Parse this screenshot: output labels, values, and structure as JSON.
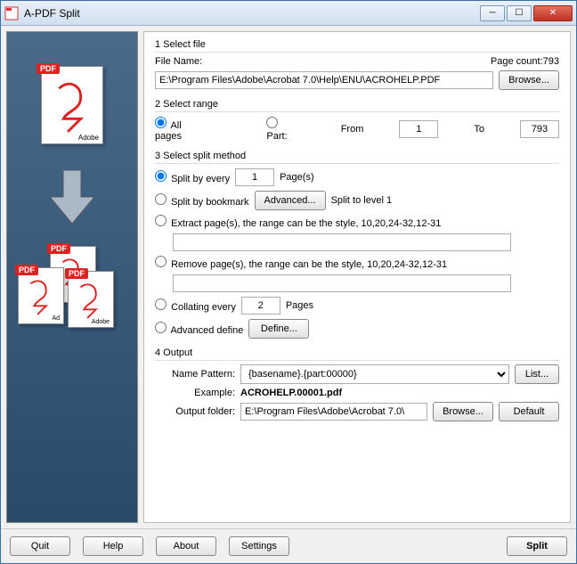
{
  "window": {
    "title": "A-PDF Split"
  },
  "section1": {
    "title": "1 Select file",
    "fileNameLabel": "File Name:",
    "fileName": "E:\\Program Files\\Adobe\\Acrobat 7.0\\Help\\ENU\\ACROHELP.PDF",
    "browse": "Browse...",
    "pageCountLabel": "Page count:",
    "pageCount": "793"
  },
  "section2": {
    "title": "2 Select range",
    "allPages": "All pages",
    "part": "Part:",
    "fromLabel": "From",
    "fromValue": "1",
    "toLabel": "To",
    "toValue": "793"
  },
  "section3": {
    "title": "3 Select split method",
    "splitEvery": "Split by every",
    "splitEveryValue": "1",
    "pagesSuffix": "Page(s)",
    "splitBookmark": "Split by bookmark",
    "advanced": "Advanced...",
    "splitToLevel": "Split to level 1",
    "extractPages": "Extract page(s), the range can be the style, 10,20,24-32,12-31",
    "removePages": "Remove page(s), the range can be the style, 10,20,24-32,12-31",
    "collatingEvery": "Collating every",
    "collatingValue": "2",
    "pagesSuffix2": "Pages",
    "advancedDefine": "Advanced define",
    "define": "Define..."
  },
  "section4": {
    "title": "4 Output",
    "namePatternLabel": "Name Pattern:",
    "namePattern": "{basename}.{part:00000}",
    "list": "List...",
    "exampleLabel": "Example:",
    "exampleValue": "ACROHELP.00001.pdf",
    "outputFolderLabel": "Output folder:",
    "outputFolder": "E:\\Program Files\\Adobe\\Acrobat 7.0\\",
    "browse": "Browse...",
    "default": "Default"
  },
  "footer": {
    "quit": "Quit",
    "help": "Help",
    "about": "About",
    "settings": "Settings",
    "split": "Split"
  }
}
